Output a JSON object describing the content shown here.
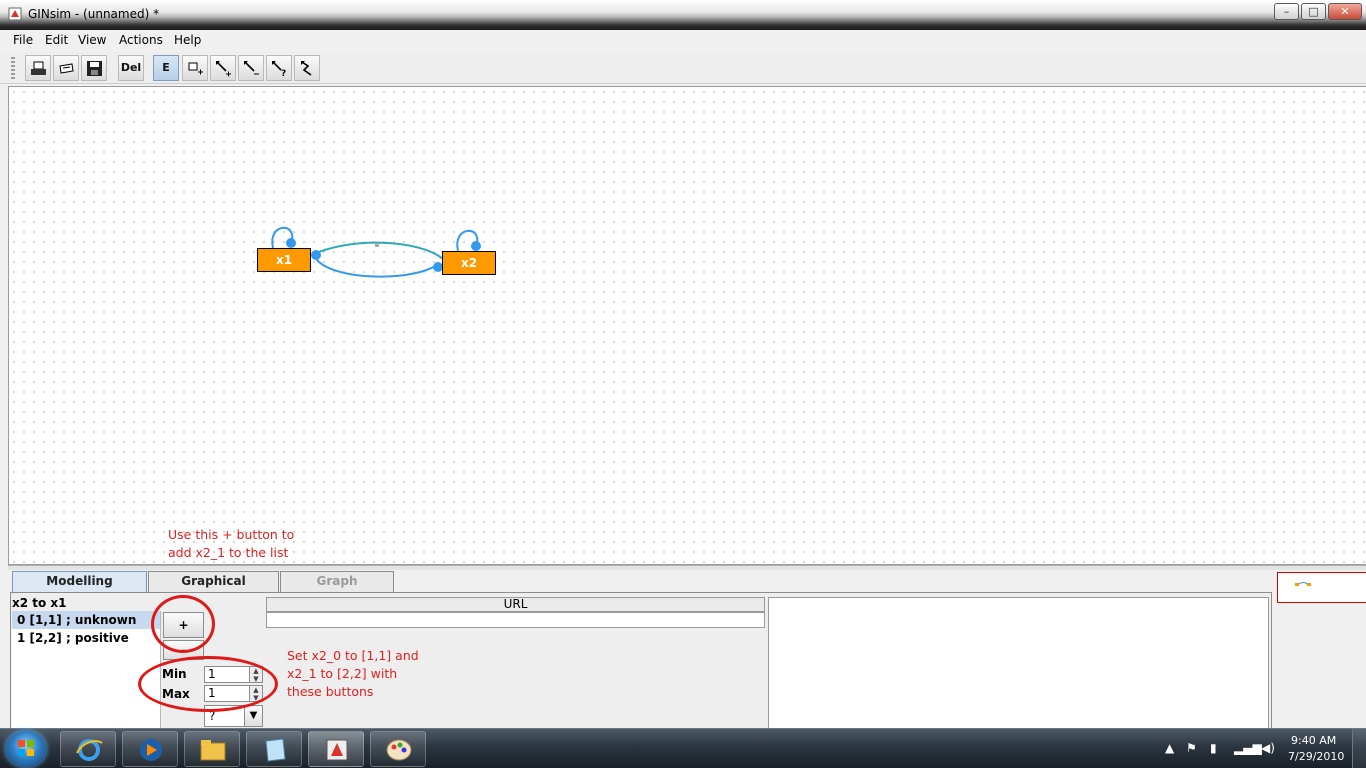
{
  "window": {
    "title": "GINsim -  (unnamed) *",
    "controls": {
      "minimize": "–",
      "maximize": "□",
      "close": "✕"
    }
  },
  "menu": [
    "File",
    "Edit",
    "View",
    "Actions",
    "Help"
  ],
  "toolbar": {
    "delete_label": "Del",
    "edit_mode_label": "E",
    "selected_tool": "E",
    "tools": [
      "print-icon",
      "open-icon",
      "save-icon",
      "delete",
      "edit-mode",
      "add-node-icon",
      "add-positive-edge-icon",
      "add-negative-edge-icon",
      "add-unknown-edge-icon",
      "add-dual-edge-icon"
    ]
  },
  "graph": {
    "nodes": [
      {
        "id": "x1",
        "label": "x1"
      },
      {
        "id": "x2",
        "label": "x2"
      }
    ],
    "node_color": "#ff9900",
    "edge_color": "#3399ee",
    "edges": [
      {
        "from": "x1",
        "to": "x1"
      },
      {
        "from": "x2",
        "to": "x2"
      },
      {
        "from": "x1",
        "to": "x2"
      },
      {
        "from": "x2",
        "to": "x1"
      }
    ]
  },
  "annotations": {
    "top": [
      "Use this + button to",
      "add x2_1 to the list"
    ],
    "right": [
      "Set x2_0 to [1,1] and",
      "x2_1 to [2,2] with",
      "these buttons"
    ],
    "color": "#e02020"
  },
  "tabs": [
    {
      "label": "Modelling Attributes",
      "state": "selected"
    },
    {
      "label": "Graphical Attributes",
      "state": "normal"
    },
    {
      "label": "Graph Attributes",
      "state": "disabled"
    }
  ],
  "edge_panel": {
    "edge_label": "x2 to x1",
    "interactions": [
      {
        "index": "0",
        "text": " [1,1] ; unknown",
        "selected": true
      },
      {
        "index": "1",
        "text": " [2,2] ; positive",
        "selected": false
      }
    ],
    "add_label": "+",
    "min_label": "Min",
    "min_value": "1",
    "max_label": "Max",
    "max_value": "1",
    "sign_value": "?"
  },
  "url_table": {
    "header": "URL",
    "value": ""
  },
  "taskbar": {
    "time": "9:40 AM",
    "date": "7/29/2010",
    "apps": [
      "internet-explorer-icon",
      "media-player-icon",
      "file-explorer-icon",
      "notepad-icon",
      "ginsim-icon",
      "paint-icon"
    ],
    "active_app": "ginsim-icon"
  }
}
